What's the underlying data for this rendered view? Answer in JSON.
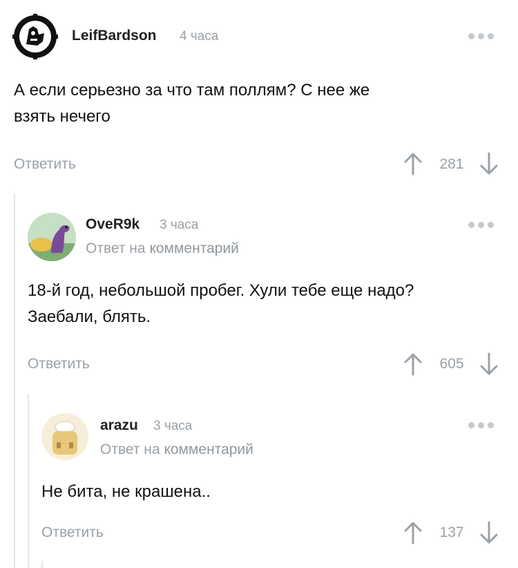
{
  "comments": [
    {
      "author": "LeifBardson",
      "time": "4 часа",
      "text_lines": [
        "А если серьезно за что там поллям? С нее же",
        "взять нечего"
      ],
      "reply_label": "Ответить",
      "score": "281"
    },
    {
      "author": "OveR9k",
      "time": "3 часа",
      "reply_prefix": "Ответ на",
      "reply_link": "комментарий",
      "text_lines": [
        "18-й год, небольшой пробег. Хули тебе еще надо?",
        "Заебали, блять."
      ],
      "reply_label": "Ответить",
      "score": "605"
    },
    {
      "author": "arazu",
      "time": "3 часа",
      "reply_prefix": "Ответ на",
      "reply_link": "комментарий",
      "text_lines": [
        "Не бита, не крашена.."
      ],
      "reply_label": "Ответить",
      "score": "137"
    }
  ],
  "colors": {
    "thread_line": "#e3e6ea",
    "muted": "#9aa1a7",
    "text": "#111111"
  },
  "icons": [
    "more-icon",
    "arrow-up-icon",
    "arrow-down-icon"
  ]
}
